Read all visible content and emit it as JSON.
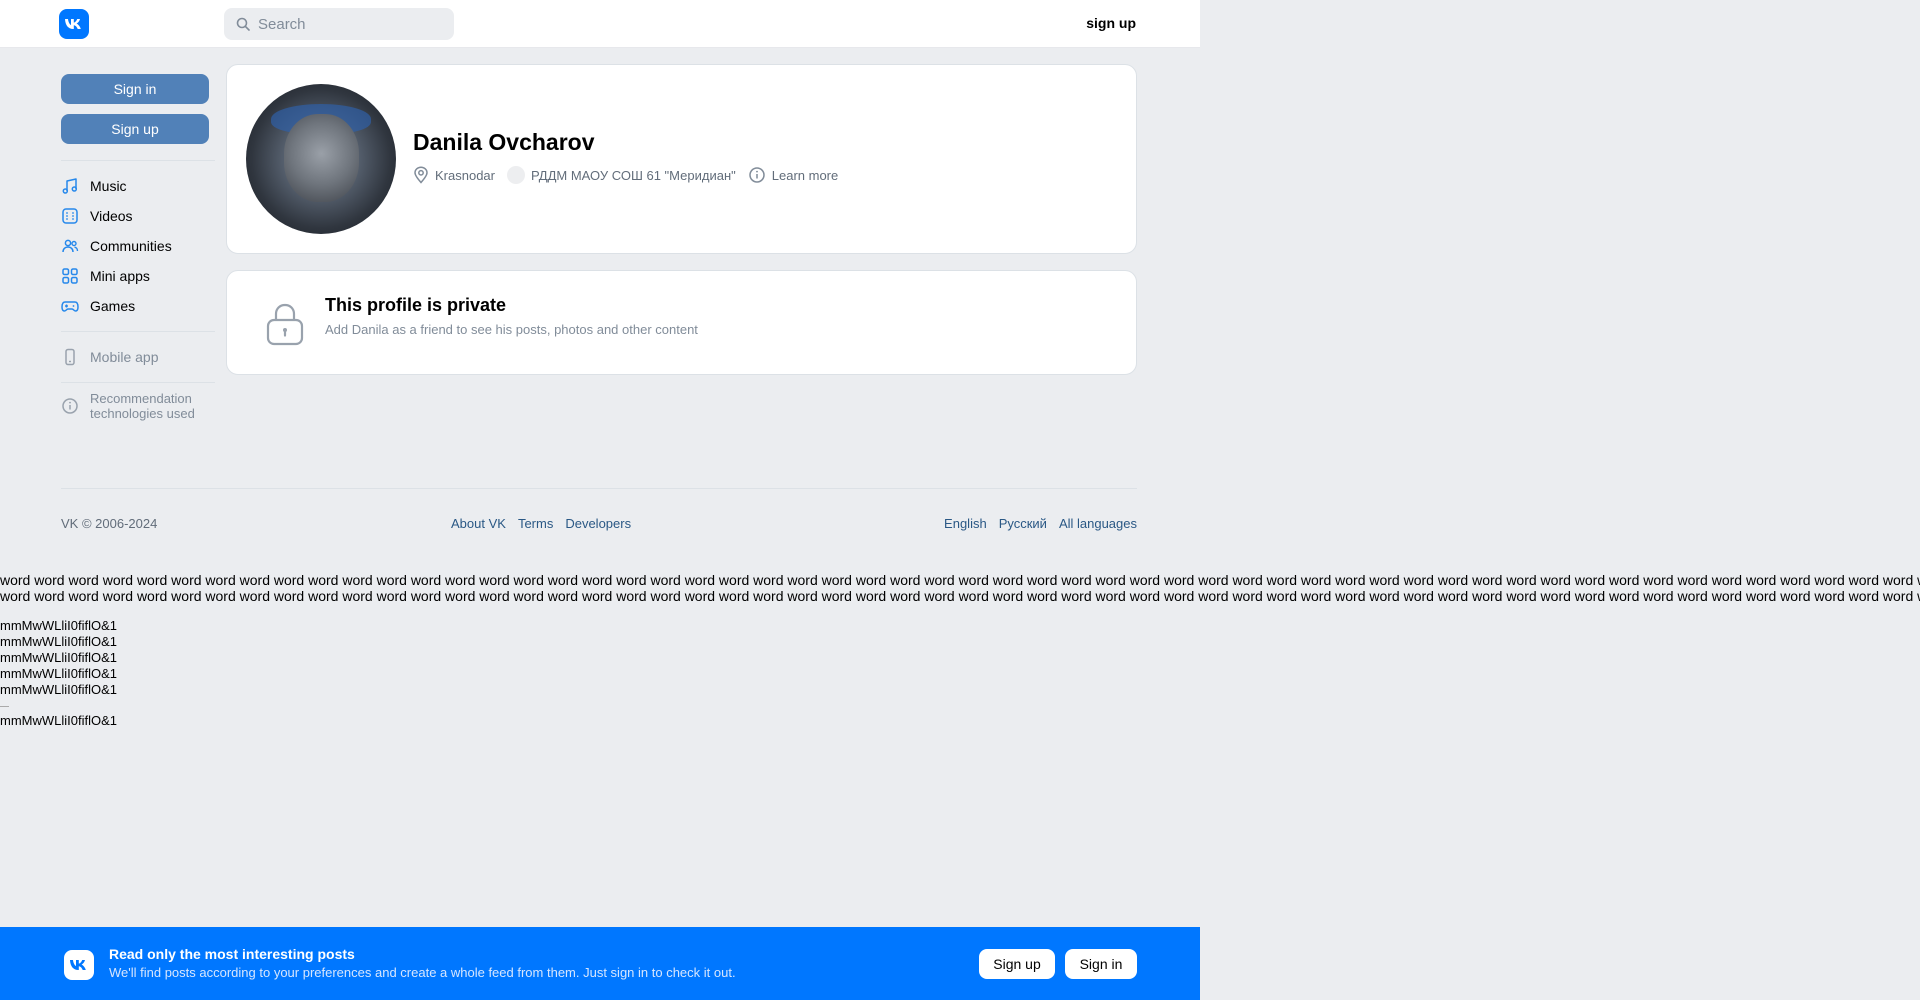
{
  "header": {
    "search_placeholder": "Search",
    "signup_label": "sign up"
  },
  "sidebar": {
    "signin_label": "Sign in",
    "signup_label": "Sign up",
    "items": [
      {
        "label": "Music",
        "icon": "music-icon"
      },
      {
        "label": "Videos",
        "icon": "video-icon"
      },
      {
        "label": "Communities",
        "icon": "communities-icon"
      },
      {
        "label": "Mini apps",
        "icon": "apps-icon"
      },
      {
        "label": "Games",
        "icon": "gamepad-icon"
      }
    ],
    "mobile_app": "Mobile app",
    "recommendation_line1": "Recommendation",
    "recommendation_line2": "technologies used"
  },
  "profile": {
    "name": "Danila Ovcharov",
    "city": "Krasnodar",
    "school": "РДДМ МАОУ СОШ 61 \"Меридиан\"",
    "learn_more": "Learn more"
  },
  "private": {
    "title": "This profile is private",
    "subtitle": "Add Danila as a friend to see his posts, photos and other content"
  },
  "footer": {
    "copyright": "VK © 2006-2024",
    "links": [
      "About VK",
      "Terms",
      "Developers"
    ],
    "languages": [
      "English",
      "Русский",
      "All languages"
    ]
  },
  "test_text": {
    "word": "word",
    "mm_line": "mmMwWLliI0fiflO&1"
  },
  "banner": {
    "title": "Read only the most interesting posts",
    "subtitle": "We'll find posts according to your preferences and create a whole feed from them. Just sign in to check it out.",
    "signup_label": "Sign up",
    "signin_label": "Sign in"
  },
  "colors": {
    "accent": "#0077ff",
    "button_blue": "#5181b8",
    "link": "#2a5885",
    "background": "#ebedf0"
  }
}
